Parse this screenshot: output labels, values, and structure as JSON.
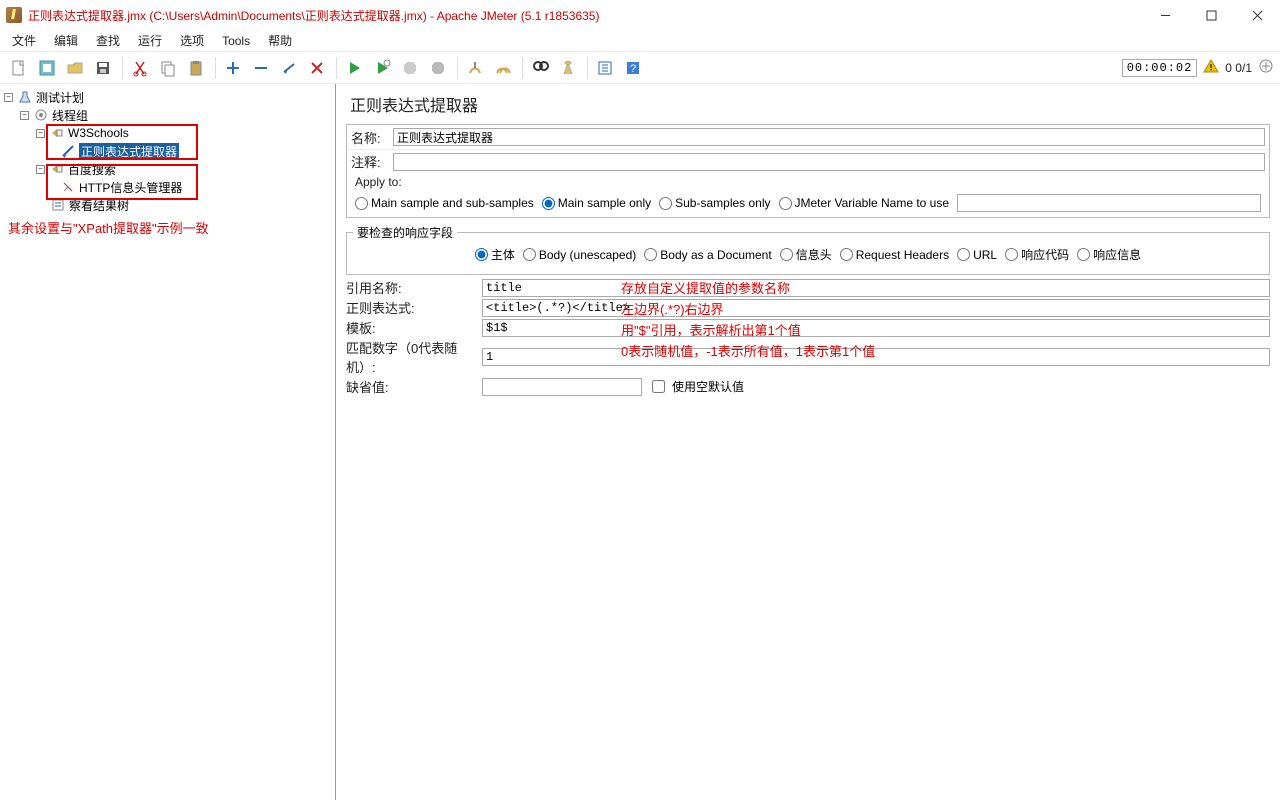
{
  "window": {
    "title": "正则表达式提取器.jmx (C:\\Users\\Admin\\Documents\\正则表达式提取器.jmx) - Apache JMeter (5.1 r1853635)"
  },
  "menu": {
    "items": [
      "文件",
      "编辑",
      "查找",
      "运行",
      "选项",
      "Tools",
      "帮助"
    ]
  },
  "toolbar": {
    "time": "00:00:02",
    "thread_counter": "0  0/1"
  },
  "tree": {
    "items": [
      {
        "label": "测试计划",
        "indent": 0,
        "toggle": "-",
        "icon": "beaker-icon"
      },
      {
        "label": "线程组",
        "indent": 1,
        "toggle": "-",
        "icon": "thread-icon"
      },
      {
        "label": "W3Schools",
        "indent": 2,
        "toggle": "-",
        "icon": "http-icon"
      },
      {
        "label": "正则表达式提取器",
        "indent": 3,
        "toggle": "",
        "icon": "regex-icon",
        "selected": true
      },
      {
        "label": "百度搜索",
        "indent": 2,
        "toggle": "-",
        "icon": "http-icon"
      },
      {
        "label": "HTTP信息头管理器",
        "indent": 3,
        "toggle": "",
        "icon": "header-icon"
      },
      {
        "label": "察看结果树",
        "indent": 2,
        "toggle": "",
        "icon": "results-icon"
      }
    ],
    "note": "其余设置与\"XPath提取器\"示例一致"
  },
  "panel": {
    "title": "正则表达式提取器",
    "name_label": "名称:",
    "name_value": "正则表达式提取器",
    "comment_label": "注释:",
    "comment_value": "",
    "apply_to_legend": "Apply to:",
    "apply_to": {
      "options": [
        "Main sample and sub-samples",
        "Main sample only",
        "Sub-samples only",
        "JMeter Variable Name to use"
      ],
      "selected": "Main sample only",
      "var_value": ""
    },
    "response_field_legend": "要检查的响应字段",
    "response_field": {
      "options": [
        "主体",
        "Body (unescaped)",
        "Body as a Document",
        "信息头",
        "Request Headers",
        "URL",
        "响应代码",
        "响应信息"
      ],
      "selected": "主体"
    },
    "fields": {
      "ref_name_label": "引用名称:",
      "ref_name_value": "title",
      "ref_name_ann": "存放自定义提取值的参数名称",
      "regex_label": "正则表达式:",
      "regex_value": "<title>(.*?)</title>",
      "regex_ann": "左边界(.*?)右边界",
      "template_label": "模板:",
      "template_value": "$1$",
      "template_ann": "用\"$\"引用，表示解析出第1个值",
      "match_label": "匹配数字（0代表随机）:",
      "match_value": "1",
      "match_ann": "0表示随机值，-1表示所有值，1表示第1个值",
      "default_label": "缺省值:",
      "default_value": "",
      "default_cb_label": "使用空默认值"
    }
  }
}
